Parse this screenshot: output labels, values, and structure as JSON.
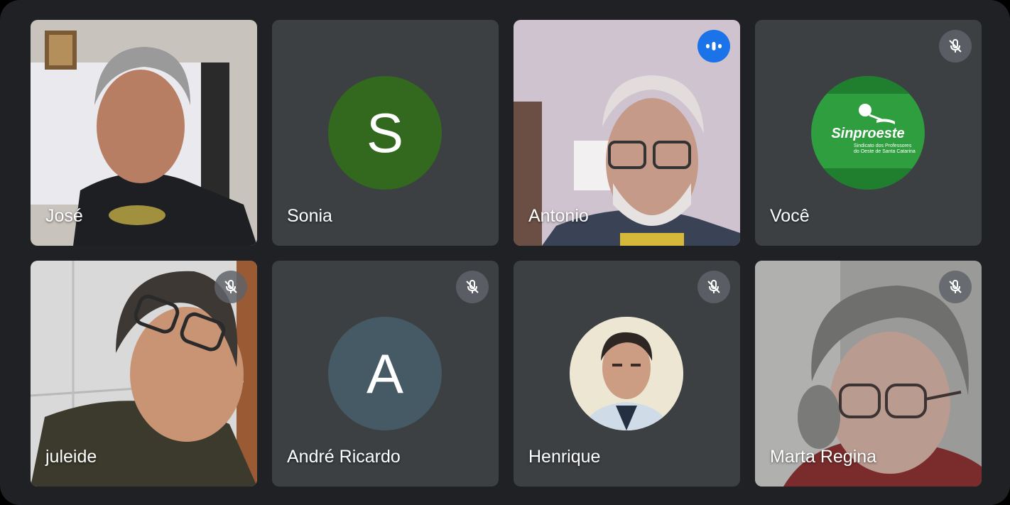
{
  "participants": [
    {
      "name": "José",
      "mic": "on"
    },
    {
      "name": "Sonia",
      "initial": "S",
      "avatar_color": "#33691e",
      "mic": "on"
    },
    {
      "name": "Antonio",
      "mic": "speaking"
    },
    {
      "name": "Você",
      "mic": "muted",
      "logo": {
        "title": "Sinproeste",
        "line1": "Sindicato dos Professores",
        "line2": "do Oeste de Santa Catarina",
        "color": "#2e9e3e"
      }
    },
    {
      "name": "juleide",
      "mic": "muted"
    },
    {
      "name": "André Ricardo",
      "initial": "A",
      "avatar_color": "#455a64",
      "mic": "muted"
    },
    {
      "name": "Henrique",
      "mic": "muted"
    },
    {
      "name": "Marta Regina",
      "mic": "muted"
    }
  ],
  "icons": {
    "muted": "mic-off-icon",
    "speaking": "speaking-indicator-icon"
  },
  "colors": {
    "background": "#202124",
    "tile": "#3c4043",
    "speaking": "#1a73e8"
  }
}
